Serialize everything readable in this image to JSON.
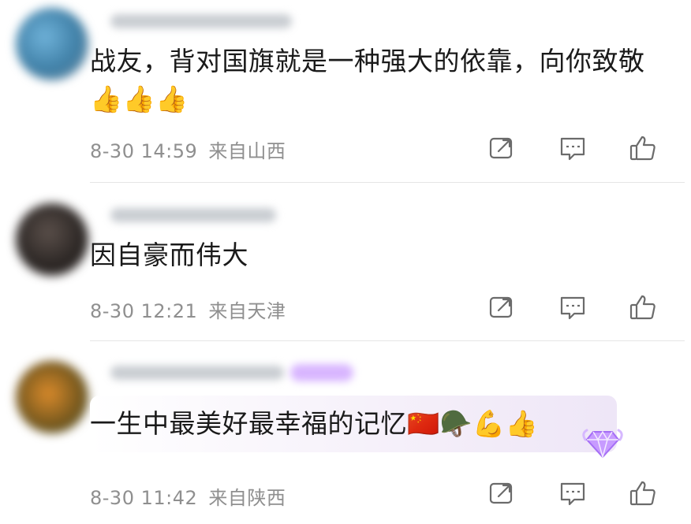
{
  "comments": [
    {
      "text": "战友，背对国旗就是一种强大的依靠，向你致敬👍👍👍",
      "date": "8-30 14:59",
      "location": "来自山西"
    },
    {
      "text": "因自豪而伟大",
      "date": "8-30 12:21",
      "location": "来自天津"
    },
    {
      "text": "一生中最美好最幸福的记忆🇨🇳🪖💪👍",
      "date": "8-30 11:42",
      "location": "来自陕西"
    }
  ],
  "icons": {
    "share": "share-icon",
    "comment": "comment-icon",
    "like": "like-icon",
    "badge": "diamond-badge-icon"
  },
  "colors": {
    "meta": "#8f8f8f",
    "bubble": "#eee6f7",
    "badge": "#c79bff"
  }
}
